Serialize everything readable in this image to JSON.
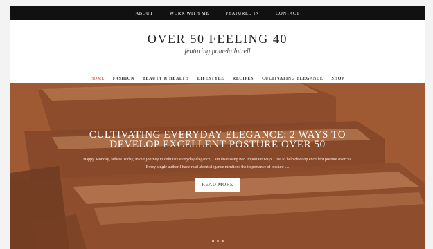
{
  "topbar": {
    "items": [
      {
        "label": "ABOUT"
      },
      {
        "label": "WORK WITH ME"
      },
      {
        "label": "FEATURED IN"
      },
      {
        "label": "CONTACT"
      }
    ]
  },
  "header": {
    "title": "OVER 50 FEELING 40",
    "tagline": "featuring pamela lutrell"
  },
  "nav": {
    "items": [
      {
        "label": "HOME",
        "active": true
      },
      {
        "label": "FASHION"
      },
      {
        "label": "BEAUTY & HEALTH"
      },
      {
        "label": "LIFESTYLE"
      },
      {
        "label": "RECIPES"
      },
      {
        "label": "CULTIVATING ELEGANCE"
      },
      {
        "label": "SHOP"
      }
    ]
  },
  "hero": {
    "title": "CULTIVATING EVERYDAY ELEGANCE: 2 WAYS TO DEVELOP EXCELLENT POSTURE OVER 50",
    "excerpt": "Happy Monday, ladies! Today, in our journey to cultivate everyday elegance, I am discussing two important ways I use to help develop excellent posture over 50. Every single author I have read about elegance mentions the importance of posture …",
    "button_label": "READ MORE",
    "slide_count": 3,
    "active_slide": 1
  },
  "colors": {
    "topbar_bg": "#111111",
    "nav_active": "#c0392b",
    "hero_tint": "#a8623a"
  }
}
